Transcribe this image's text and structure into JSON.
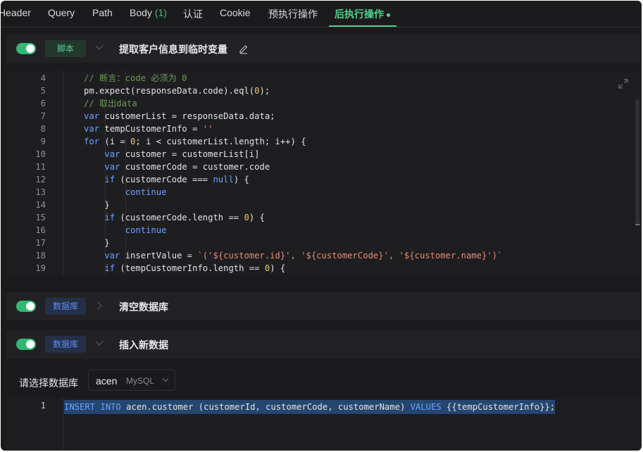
{
  "tabs": [
    {
      "label": "Header"
    },
    {
      "label": "Query"
    },
    {
      "label": "Path"
    },
    {
      "label": "Body",
      "count": "(1)"
    },
    {
      "label": "认证"
    },
    {
      "label": "Cookie"
    },
    {
      "label": "预执行操作"
    },
    {
      "label": "后执行操作",
      "active": true
    }
  ],
  "steps": [
    {
      "enabled": true,
      "type": "脚本",
      "title": "提取客户信息到临时变量",
      "expanded": true
    },
    {
      "enabled": true,
      "type": "数据库",
      "title": "清空数据库",
      "expanded": false
    },
    {
      "enabled": true,
      "type": "数据库",
      "title": "插入新数据",
      "expanded": true
    }
  ],
  "code_lines": [
    {
      "n": "4",
      "t": "// 断言：code 必须为 0"
    },
    {
      "n": "5",
      "t": "pm.expect(responseData.code).eql(0);"
    },
    {
      "n": "6",
      "t": "// 取出data"
    },
    {
      "n": "7",
      "t": "var customerList = responseData.data;"
    },
    {
      "n": "8",
      "t": "var tempCustomerInfo = ''"
    },
    {
      "n": "9",
      "t": "for (i = 0; i < customerList.length; i++) {"
    },
    {
      "n": "10",
      "t": "    var customer = customerList[i]"
    },
    {
      "n": "11",
      "t": "    var customerCode = customer.code"
    },
    {
      "n": "12",
      "t": "    if (customerCode === null) {"
    },
    {
      "n": "13",
      "t": "        continue"
    },
    {
      "n": "14",
      "t": "    }"
    },
    {
      "n": "15",
      "t": "    if (customerCode.length == 0) {"
    },
    {
      "n": "16",
      "t": "        continue"
    },
    {
      "n": "17",
      "t": "    }"
    },
    {
      "n": "18",
      "t": "    var insertValue = `('${customer.id}', '${customerCode}', '${customer.name}')`"
    },
    {
      "n": "19",
      "t": "    if (tempCustomerInfo.length == 0) {"
    }
  ],
  "db_selector": {
    "label": "请选择数据库",
    "name": "acen",
    "type": "MySQL"
  },
  "sql": {
    "line_number": "1",
    "keyword_insert": "INSERT INTO",
    "table_part": "acen.customer (customerId, customerCode, customerName)",
    "keyword_values": "VALUES",
    "value_part": "{{tempCustomerInfo}};"
  },
  "colors": {
    "accent": "#4fd28e",
    "keyword": "#6ea0ff",
    "comment": "#6a9955",
    "string": "#e48c74",
    "number": "#e8c86a"
  }
}
